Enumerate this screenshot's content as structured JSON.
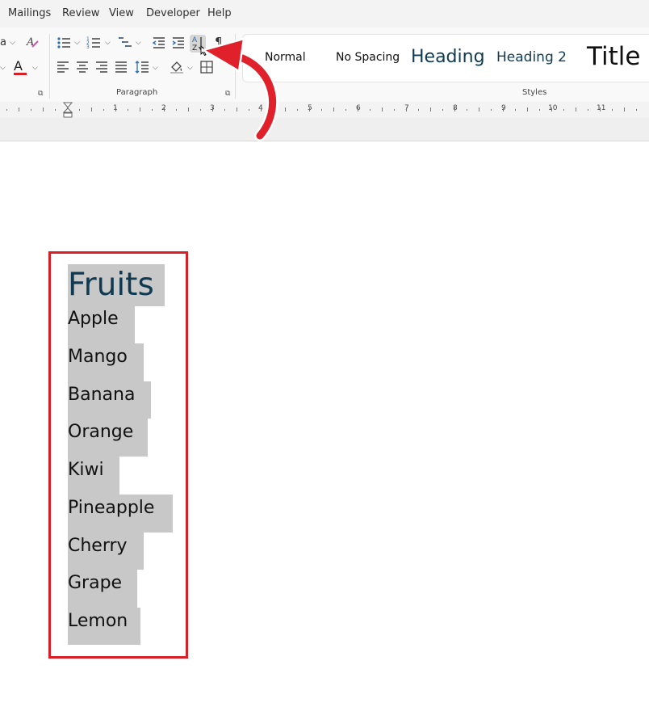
{
  "menu": {
    "items": [
      "Mailings",
      "Review",
      "View",
      "Developer",
      "Help"
    ]
  },
  "ribbon": {
    "font_group": {
      "font_glyph_a": "a",
      "font_color_glyph": "A"
    },
    "paragraph": {
      "label": "Paragraph",
      "sort_button": {
        "glyph_top": "A",
        "glyph_bottom": "Z"
      },
      "show_marks_glyph": "¶"
    },
    "styles": {
      "label": "Styles",
      "items": [
        "Normal",
        "No Spacing",
        "Heading",
        "Heading 2",
        "Title"
      ]
    }
  },
  "ruler": {
    "numbers": [
      "1",
      "2",
      "3",
      "4",
      "5",
      "6",
      "7",
      "8",
      "9",
      "10",
      "11"
    ]
  },
  "document": {
    "title": "Fruits",
    "items": [
      "Apple",
      "Mango",
      "Banana",
      "Orange",
      "Kiwi",
      "Pineapple",
      "Cherry",
      "Grape",
      "Lemon"
    ]
  },
  "colors": {
    "heading": "#0f3a52",
    "highlight_box": "#d81f26",
    "selection": "#c8c8c8",
    "arrow": "#e0202a"
  }
}
